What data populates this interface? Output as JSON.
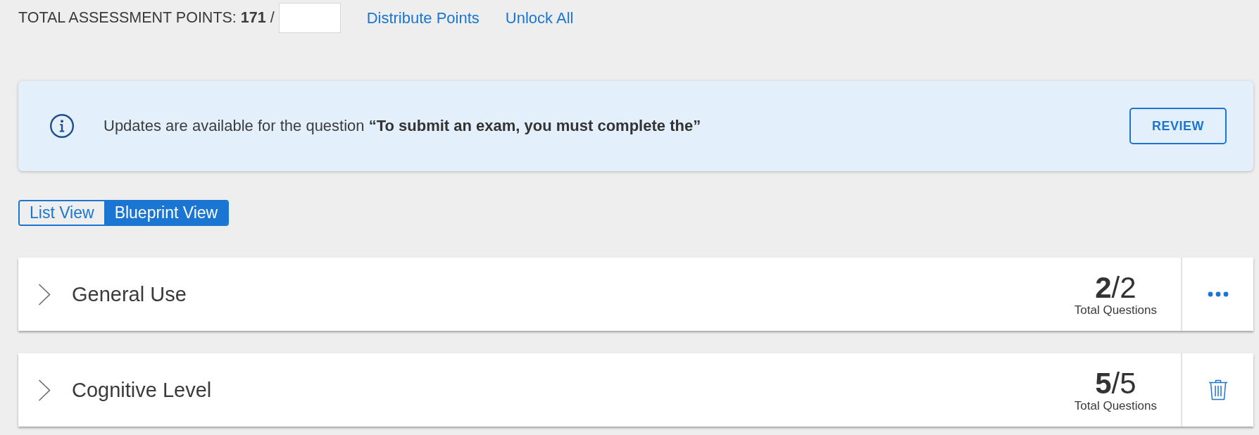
{
  "points_bar": {
    "label": "TOTAL ASSESSMENT POINTS: **171** /",
    "links": [
      "Distribute Points",
      "Unlock All"
    ]
  },
  "update_banner": {
    "message": "Updates are available for the question **“To submit an exam, you must complete the”**",
    "button": "REVIEW"
  },
  "view_toggle": [
    {
      "label": "List View",
      "selected": false
    },
    {
      "label": "Blueprint View",
      "selected": true
    }
  ],
  "sections": [
    {
      "title": "General Use",
      "expanded": false,
      "count": "**2**/2",
      "caption": "Total Questions",
      "kind": "menu"
    },
    {
      "title": "Cognitive Level",
      "expanded": false,
      "count": "**5**/5",
      "caption": "Total Questions",
      "kind": "delete"
    }
  ]
}
